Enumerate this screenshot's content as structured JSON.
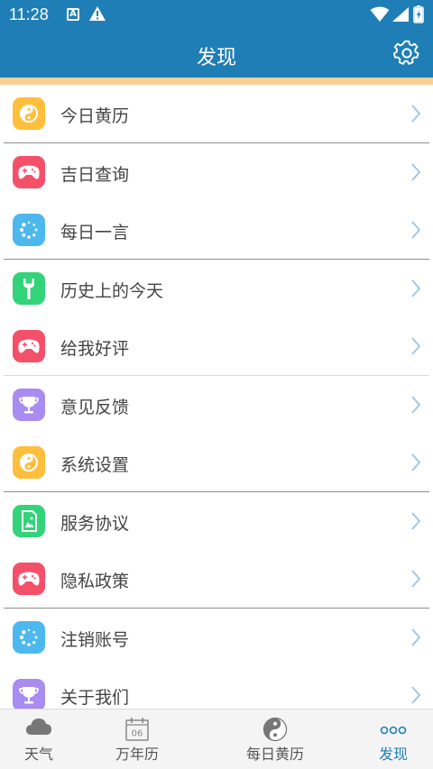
{
  "status_bar": {
    "time": "11:28",
    "notification_letter": "A"
  },
  "header": {
    "title": "发现",
    "settings_icon": "gear-icon"
  },
  "colors": {
    "header_bg": "#1f7eb5",
    "accent_strip": "#f8cf94",
    "orange": "#ffbe3c",
    "red": "#f5506a",
    "blue": "#4cb8ee",
    "green": "#33d37a",
    "purple": "#a98cf0",
    "active_tab": "#1f7eb5"
  },
  "menu": {
    "items": [
      {
        "label": "今日黄历",
        "icon": "yin-yang-icon",
        "color": "orange"
      },
      {
        "label": "吉日查询",
        "icon": "gamepad-icon",
        "color": "red"
      },
      {
        "label": "每日一言",
        "icon": "loading-dots-icon",
        "color": "blue"
      },
      {
        "label": "历史上的今天",
        "icon": "wrench-icon",
        "color": "green"
      },
      {
        "label": "给我好评",
        "icon": "gamepad-icon",
        "color": "red"
      },
      {
        "label": "意见反馈",
        "icon": "trophy-icon",
        "color": "purple"
      },
      {
        "label": "系统设置",
        "icon": "yin-yang-icon",
        "color": "orange"
      },
      {
        "label": "服务协议",
        "icon": "image-file-icon",
        "color": "green"
      },
      {
        "label": "隐私政策",
        "icon": "gamepad-icon",
        "color": "red"
      },
      {
        "label": "注销账号",
        "icon": "loading-dots-icon",
        "color": "blue"
      },
      {
        "label": "关于我们",
        "icon": "trophy-icon",
        "color": "purple"
      }
    ]
  },
  "tab_bar": {
    "tabs": [
      {
        "label": "天气",
        "icon": "cloud-icon",
        "active": false
      },
      {
        "label": "万年历",
        "icon": "calendar-icon",
        "icon_text": "06",
        "active": false
      },
      {
        "label": "每日黄历",
        "icon": "yin-yang-icon",
        "active": false
      },
      {
        "label": "发现",
        "icon": "more-dots-icon",
        "active": true
      }
    ]
  }
}
